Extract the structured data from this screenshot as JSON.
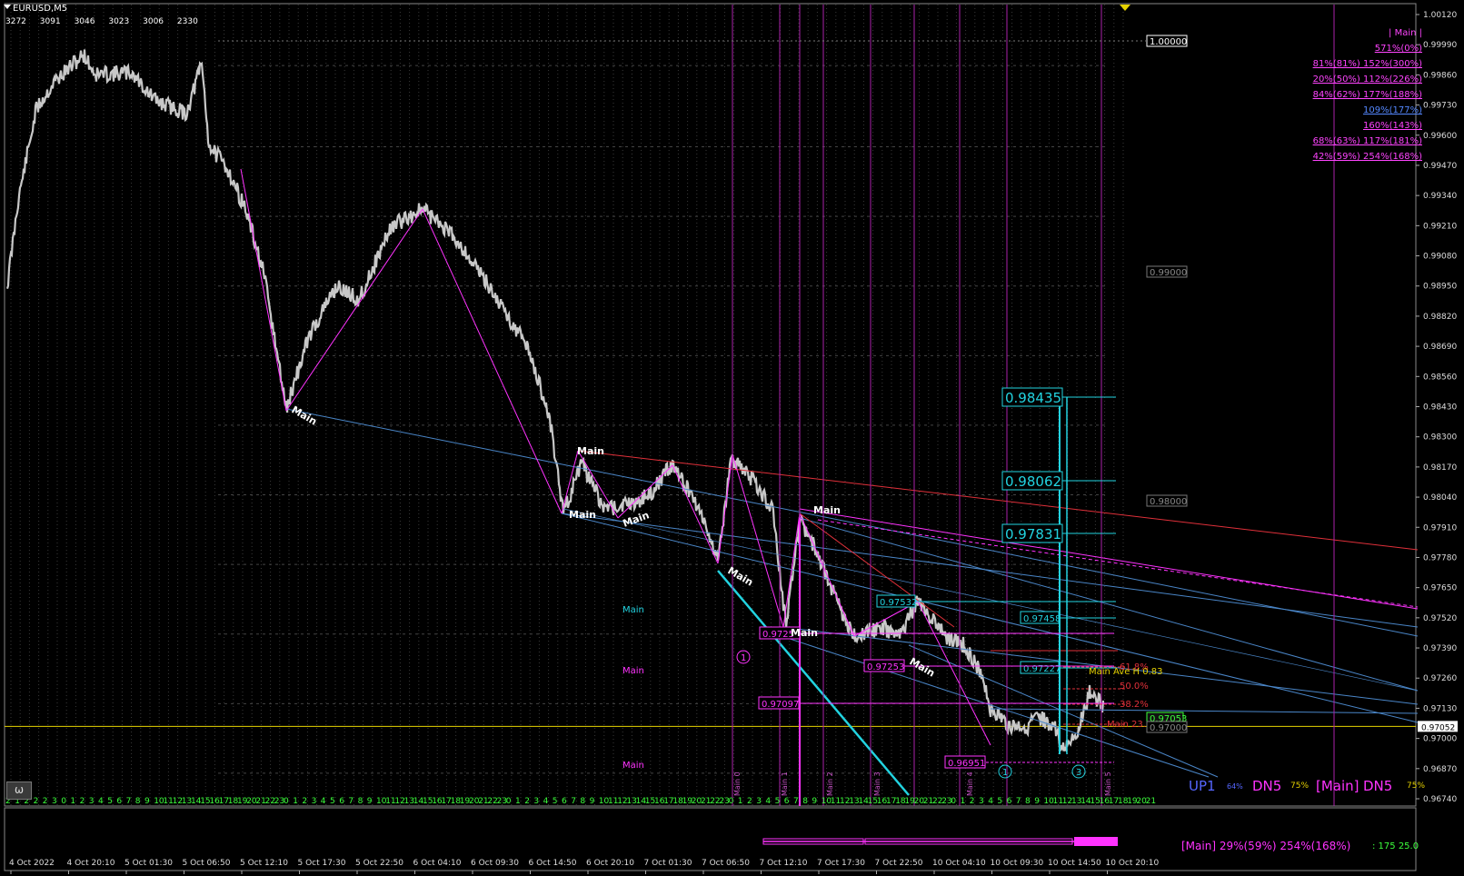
{
  "window": {
    "symbol": "EURUSD,M5",
    "ticks": [
      "3272",
      "3091",
      "3046",
      "3023",
      "3006",
      "2330"
    ],
    "omega_button": "ω"
  },
  "price_axis": {
    "labels": [
      "1.00120",
      "0.99990",
      "0.99860",
      "0.99730",
      "0.99600",
      "0.99470",
      "0.99340",
      "0.99210",
      "0.99080",
      "0.98950",
      "0.98820",
      "0.98690",
      "0.98560",
      "0.98430",
      "0.98300",
      "0.98170",
      "0.98040",
      "0.97910",
      "0.97780",
      "0.97650",
      "0.97520",
      "0.97390",
      "0.97260",
      "0.97130",
      "0.97000",
      "0.96870",
      "0.96740"
    ],
    "current_price": "0.97052"
  },
  "time_axis": {
    "labels": [
      "4 Oct 2022",
      "4 Oct 20:10",
      "5 Oct 01:30",
      "5 Oct 06:50",
      "5 Oct 12:10",
      "5 Oct 17:30",
      "5 Oct 22:50",
      "6 Oct 04:10",
      "6 Oct 09:30",
      "6 Oct 14:50",
      "6 Oct 20:10",
      "7 Oct 01:30",
      "7 Oct 06:50",
      "7 Oct 12:10",
      "7 Oct 17:30",
      "7 Oct 22:50",
      "10 Oct 04:10",
      "10 Oct 09:30",
      "10 Oct 14:50",
      "10 Oct 20:10"
    ],
    "hour_ticks": "2 1 2 2 2 3 0 1 2 3 4 5 6 7 8 9 10 11 12 13 14 15 16 17 18 19 20 21 22 23 0 1 2 3 4 5 6 7 8 9 10 11 12 13 14 15 16 17 18 19 20 21 22 23 0 1 2 3 4 5 6 7 8 9 10 11 12 13 14 15 16 17 18 19 20 21 22 23 0 1 2 3 4 5 6 7 8 9 10 11 12 13 14 15 16 17 18 19 20 21 22 23 0 1 2 3 4 5 6 7 8 9 10 11 12 13 14 15 16 17 18 19 20 21 22 23 0 1 2 3 4 5 6"
  },
  "levels": {
    "white_box": "1.00000",
    "gray_boxes": [
      "0.99000",
      "0.98000",
      "0.97000"
    ],
    "cyan_targets": [
      "0.98435",
      "0.98062",
      "0.97831",
      "0.97532",
      "0.97458",
      "0.97227"
    ],
    "magenta_boxes": [
      "0.9725",
      "0.97097",
      "0.96951",
      "0.97253"
    ],
    "green_box": "0.97053",
    "fib_labels": [
      "61.8%",
      "50.0%",
      "38.2%",
      "Main 23.6%"
    ],
    "ave_label": "Main Ave H 0.83"
  },
  "wave_labels": {
    "main": "Main",
    "circles": [
      "1",
      "1",
      "3"
    ],
    "vertical": [
      "Main 0",
      "Main 1",
      "Main 2",
      "Main 3",
      "Main 4",
      "Main 5"
    ],
    "side_labels": [
      "Main",
      "Main",
      "Main"
    ]
  },
  "legend": {
    "header": "| Main |",
    "rows": [
      {
        "text": "571%(0%)",
        "color": "#ff44ff"
      },
      {
        "text": "81%(81%)  152%(300%)",
        "color": "#ff44ff"
      },
      {
        "text": "20%(50%)  112%(226%)",
        "color": "#ff44ff"
      },
      {
        "text": "84%(62%)  177%(188%)",
        "color": "#ff44ff"
      },
      {
        "text": "109%(177%)",
        "color": "#5588ff"
      },
      {
        "text": "160%(143%)",
        "color": "#ff44ff"
      },
      {
        "text": "68%(63%)  117%(181%)",
        "color": "#ff44ff"
      },
      {
        "text": "42%(59%)  254%(168%)",
        "color": "#ff44ff"
      }
    ]
  },
  "status": {
    "up": "UP1",
    "up_pct": "64%",
    "dn": "DN5",
    "dn_pct": "75%",
    "main_bracket": "[Main]",
    "dn2": "DN5",
    "dn2_pct": "75%",
    "main_summary": "[Main] 29%(59%)  254%(168%)",
    "counter": ": 175  25.0"
  },
  "colors": {
    "background": "#000000",
    "candles": "#c8c8c8",
    "cyan": "#22d3e0",
    "magenta": "#ff33ff",
    "blue_line": "#4a86c8",
    "red_line": "#e0303a",
    "yellow": "#e6d200",
    "green_axis": "#3cff3c"
  }
}
